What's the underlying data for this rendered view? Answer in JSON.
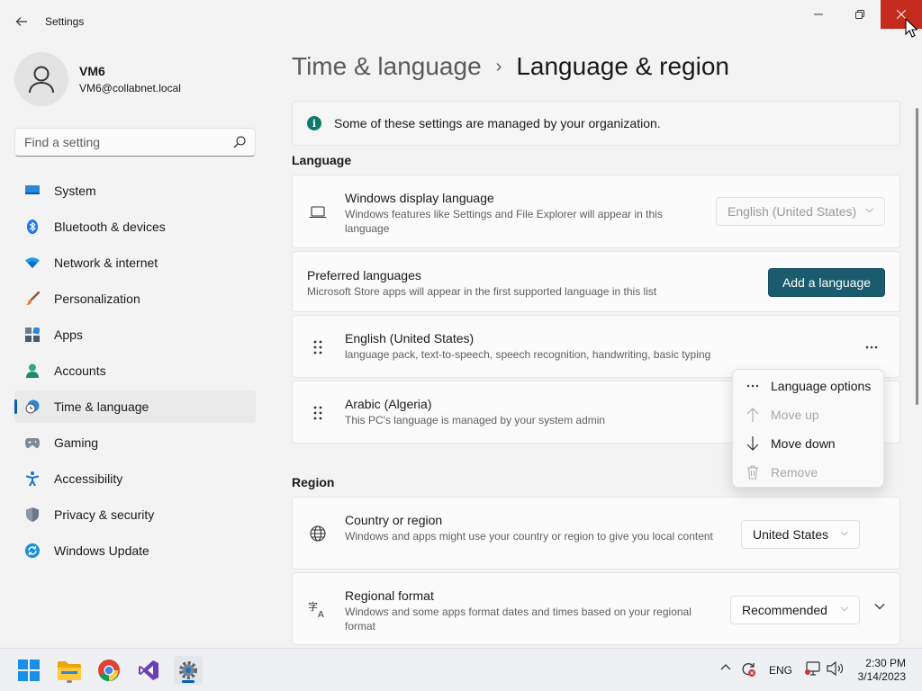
{
  "window": {
    "title": "Settings"
  },
  "profile": {
    "name": "VM6",
    "email": "VM6@collabnet.local"
  },
  "search": {
    "placeholder": "Find a setting"
  },
  "nav": [
    {
      "label": "System",
      "icon": "system-icon"
    },
    {
      "label": "Bluetooth & devices",
      "icon": "bluetooth-icon"
    },
    {
      "label": "Network & internet",
      "icon": "wifi-icon"
    },
    {
      "label": "Personalization",
      "icon": "brush-icon"
    },
    {
      "label": "Apps",
      "icon": "apps-icon"
    },
    {
      "label": "Accounts",
      "icon": "accounts-icon"
    },
    {
      "label": "Time & language",
      "icon": "clock-globe-icon",
      "active": true
    },
    {
      "label": "Gaming",
      "icon": "gamepad-icon"
    },
    {
      "label": "Accessibility",
      "icon": "accessibility-icon"
    },
    {
      "label": "Privacy & security",
      "icon": "shield-icon"
    },
    {
      "label": "Windows Update",
      "icon": "update-icon"
    }
  ],
  "breadcrumb": {
    "parent": "Time & language",
    "separator": "›",
    "current": "Language & region"
  },
  "info_bar": {
    "text": "Some of these settings are managed by your organization."
  },
  "language_section": {
    "title": "Language",
    "display_language": {
      "title": "Windows display language",
      "desc": "Windows features like Settings and File Explorer will appear in this language",
      "value": "English (United States)"
    },
    "preferred": {
      "title": "Preferred languages",
      "desc": "Microsoft Store apps will appear in the first supported language in this list",
      "button": "Add a language"
    },
    "languages": [
      {
        "name": "English (United States)",
        "desc": "language pack, text-to-speech, speech recognition, handwriting, basic typing"
      },
      {
        "name": "Arabic (Algeria)",
        "desc": "This PC's language is managed by your system admin"
      }
    ]
  },
  "context_menu": {
    "items": [
      {
        "label": "Language options",
        "icon": "more-icon",
        "enabled": true
      },
      {
        "label": "Move up",
        "icon": "arrow-up-icon",
        "enabled": false
      },
      {
        "label": "Move down",
        "icon": "arrow-down-icon",
        "enabled": true
      },
      {
        "label": "Remove",
        "icon": "trash-icon",
        "enabled": false
      }
    ]
  },
  "region_section": {
    "title": "Region",
    "country": {
      "title": "Country or region",
      "desc": "Windows and apps might use your country or region to give you local content",
      "value": "United States"
    },
    "format": {
      "title": "Regional format",
      "desc": "Windows and some apps format dates and times based on your regional format",
      "value": "Recommended"
    }
  },
  "taskbar": {
    "lang": "ENG",
    "time": "2:30 PM",
    "date": "3/14/2023"
  },
  "colors": {
    "accent": "#1a5c6e",
    "close": "#c42b1c",
    "nav_indicator": "#005fb8"
  }
}
